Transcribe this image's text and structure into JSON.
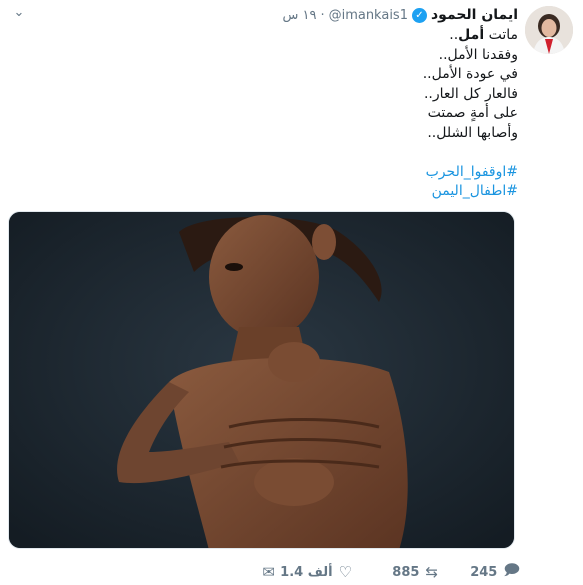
{
  "tweet": {
    "display_name": "ايمان الحمود",
    "handle": "@imankais1",
    "time": "١٩ س",
    "separator": "·",
    "text_lines": [
      {
        "pre": "ماتت ",
        "bold": "أمل",
        "post": ".."
      },
      {
        "text": "وفقدنا الأمل.."
      },
      {
        "text": "في عودة الأمل.."
      },
      {
        "text": "فالعار كل العار.."
      },
      {
        "text": "على أمةٍ صمتت"
      },
      {
        "text": "وأصابها الشلل.."
      }
    ],
    "hashtags": [
      "#اوقفوا_الحرب",
      "#اطفال_اليمن"
    ]
  },
  "actions": {
    "reply_count": "245",
    "retweet_count": "885",
    "like_count": "1.4 ألف"
  },
  "icons": {
    "caret": "chevron-down-icon",
    "verified": "verified-badge-icon",
    "reply": "reply-icon",
    "retweet": "retweet-icon",
    "like": "heart-icon",
    "dm": "envelope-icon"
  },
  "colors": {
    "link": "#1b95e0",
    "verified": "#1da1f2",
    "muted": "#657786"
  }
}
